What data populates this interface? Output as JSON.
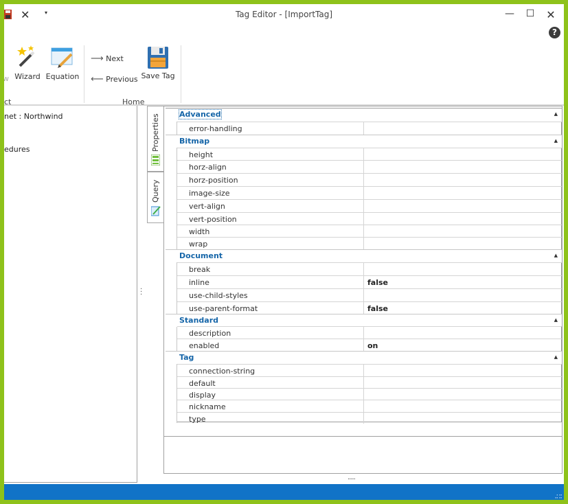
{
  "window": {
    "title": "Tag Editor - [ImportTag]"
  },
  "title_bar": {
    "minimize_glyph": "—",
    "maximize_glyph": "☐",
    "close_glyph": "✕",
    "help_glyph": "?",
    "qa_close_glyph": "✕",
    "qa_more_glyph": "▾"
  },
  "ribbon": {
    "partial_label": "w",
    "wizard": "Wizard",
    "equation": "Equation",
    "next": "Next",
    "previous": "Previous",
    "save_tag": "Save Tag",
    "group_partial": "ct",
    "group_home": "Home"
  },
  "tree": {
    "items": [
      "net : Northwind",
      "edures"
    ]
  },
  "side_tabs": {
    "properties": "Properties",
    "query": "Query"
  },
  "grid": {
    "categories": [
      {
        "name": "Advanced",
        "props": [
          {
            "name": "error-handling",
            "value": ""
          }
        ]
      },
      {
        "name": "Bitmap",
        "props": [
          {
            "name": "height",
            "value": ""
          },
          {
            "name": "horz-align",
            "value": ""
          },
          {
            "name": "horz-position",
            "value": ""
          },
          {
            "name": "image-size",
            "value": ""
          },
          {
            "name": "vert-align",
            "value": ""
          },
          {
            "name": "vert-position",
            "value": ""
          },
          {
            "name": "width",
            "value": ""
          },
          {
            "name": "wrap",
            "value": ""
          }
        ]
      },
      {
        "name": "Document",
        "props": [
          {
            "name": "break",
            "value": ""
          },
          {
            "name": "inline",
            "value": "false"
          },
          {
            "name": "use-child-styles",
            "value": ""
          },
          {
            "name": "use-parent-format",
            "value": "false"
          }
        ]
      },
      {
        "name": "Standard",
        "props": [
          {
            "name": "description",
            "value": ""
          },
          {
            "name": "enabled",
            "value": "on"
          }
        ]
      },
      {
        "name": "Tag",
        "props": [
          {
            "name": "connection-string",
            "value": ""
          },
          {
            "name": "default",
            "value": ""
          },
          {
            "name": "display",
            "value": ""
          },
          {
            "name": "nickname",
            "value": ""
          },
          {
            "name": "type",
            "value": ""
          }
        ]
      }
    ]
  },
  "colors": {
    "frame": "#8ec21a",
    "status_bar": "#1173c7",
    "category_text": "#1565a8"
  }
}
